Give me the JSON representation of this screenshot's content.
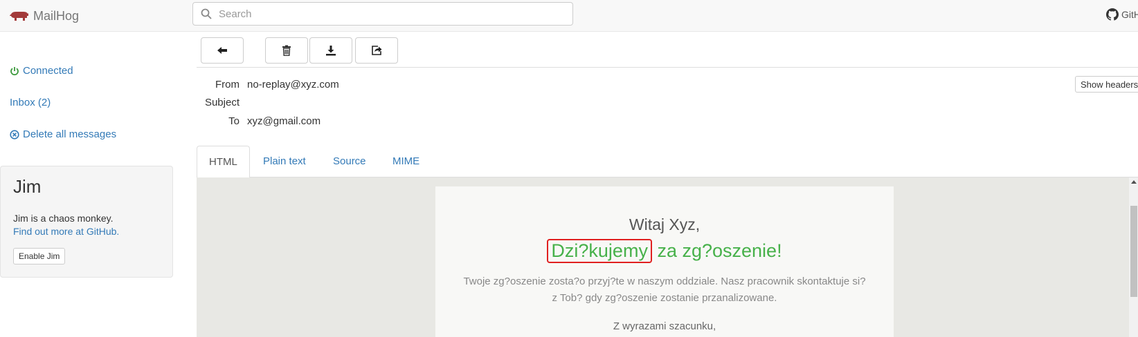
{
  "navbar": {
    "brand": "MailHog",
    "search_placeholder": "Search",
    "github_label": "GitH"
  },
  "sidebar": {
    "connected": "Connected",
    "inbox": "Inbox (2)",
    "delete_all": "Delete all messages",
    "jim": {
      "title": "Jim",
      "description": "Jim is a chaos monkey.",
      "link": "Find out more at GitHub.",
      "button": "Enable Jim"
    }
  },
  "toolbar": {
    "buttons": [
      "back-icon",
      "trash-icon",
      "download-icon",
      "share-icon"
    ]
  },
  "message": {
    "labels": {
      "from": "From",
      "subject": "Subject",
      "to": "To"
    },
    "from": "no-replay@xyz.com",
    "subject": "",
    "to": "xyz@gmail.com",
    "show_headers": "Show headers"
  },
  "tabs": [
    "HTML",
    "Plain text",
    "Source",
    "MIME"
  ],
  "active_tab": "HTML",
  "email": {
    "greeting": "Witaj Xyz,",
    "thanks_highlight": "Dzi?kujemy",
    "thanks_rest": " za zg?oszenie!",
    "body_line1": "Twoje zg?oszenie zosta?o przyj?te w naszym oddziale. Nasz pracownik skontaktuje si?",
    "body_line2": "z Tob? gdy zg?oszenie zostanie przanalizowane.",
    "regards": "Z wyrazami szacunku,"
  },
  "colors": {
    "link": "#337ab7",
    "accent_green": "#47b14a",
    "highlight_border": "#e02020",
    "brand_pig": "#a33a3a"
  }
}
